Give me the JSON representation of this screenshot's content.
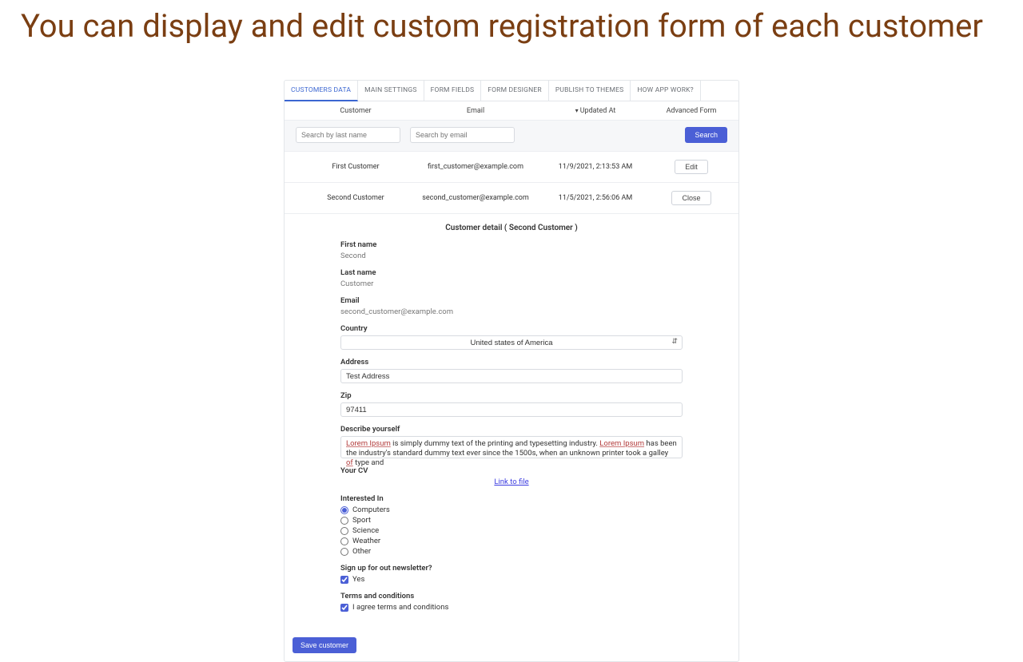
{
  "headline": "You can display and edit custom registration form of each customer",
  "tabs": [
    {
      "label": "CUSTOMERS DATA",
      "active": true
    },
    {
      "label": "MAIN SETTINGS",
      "active": false
    },
    {
      "label": "FORM FIELDS",
      "active": false
    },
    {
      "label": "FORM DESIGNER",
      "active": false
    },
    {
      "label": "PUBLISH TO THEMES",
      "active": false
    },
    {
      "label": "HOW APP WORK?",
      "active": false
    }
  ],
  "list_head": {
    "customer": "Customer",
    "email": "Email",
    "updated": "Updated At",
    "advanced": "Advanced Form"
  },
  "filters": {
    "last_name_ph": "Search by last name",
    "email_ph": "Search by email",
    "search_btn": "Search"
  },
  "rows": [
    {
      "name": "First Customer",
      "email": "first_customer@example.com",
      "updated": "11/9/2021, 2:13:53 AM",
      "action": "Edit"
    },
    {
      "name": "Second Customer",
      "email": "second_customer@example.com",
      "updated": "11/5/2021, 2:56:06 AM",
      "action": "Close"
    }
  ],
  "detail": {
    "title": "Customer detail ( Second Customer )",
    "first_name_label": "First name",
    "first_name_value": "Second",
    "last_name_label": "Last name",
    "last_name_value": "Customer",
    "email_label": "Email",
    "email_value": "second_customer@example.com",
    "country_label": "Country",
    "country_value": "United states of America",
    "address_label": "Address",
    "address_value": "Test Address",
    "zip_label": "Zip",
    "zip_value": "97411",
    "describe_label": "Describe yourself",
    "describe_value_pre1": "Lorem Ipsum",
    "describe_value_mid1": " is simply dummy text of the printing and typesetting industry. ",
    "describe_value_pre2": "Lorem Ipsum",
    "describe_value_mid2": " has been the industry's standard dummy text ever since the 1500s, when an unknown printer took a galley ",
    "describe_value_of": "of",
    "describe_value_tail": " type and",
    "cv_label": "Your CV",
    "cv_link": "Link to file",
    "interested_label": "Interested In",
    "interested_options": [
      "Computers",
      "Sport",
      "Science",
      "Weather",
      "Other"
    ],
    "interested_selected": "Computers",
    "newsletter_label": "Sign up for out newsletter?",
    "newsletter_option": "Yes",
    "terms_label": "Terms and conditions",
    "terms_option": "I agree terms and conditions",
    "save_btn": "Save customer"
  }
}
